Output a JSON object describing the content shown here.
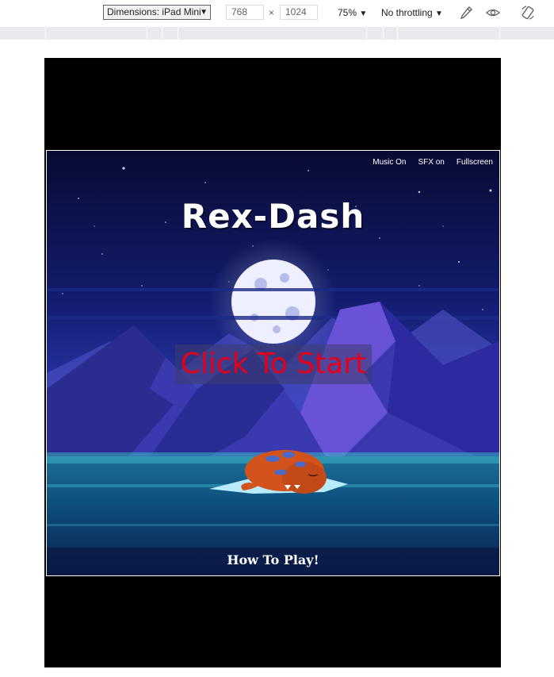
{
  "devtools": {
    "device_label": "Dimensions: iPad Mini",
    "width_value": "768",
    "height_value": "1024",
    "times_symbol": "×",
    "zoom": "75%",
    "throttling": "No throttling"
  },
  "game": {
    "music_toggle": "Music On",
    "sfx_toggle": "SFX on",
    "fullscreen": "Fullscreen",
    "title": "Rex-Dash",
    "start_label": "Click To Start",
    "how_to_play": "How To Play!"
  },
  "colors": {
    "sky_top": "#0b0f3a",
    "sky_mid": "#2433a8",
    "mountain": "#3a3cb8",
    "water": "#0e5a86",
    "start_text": "#e5001a",
    "dino": "#d4531c"
  }
}
